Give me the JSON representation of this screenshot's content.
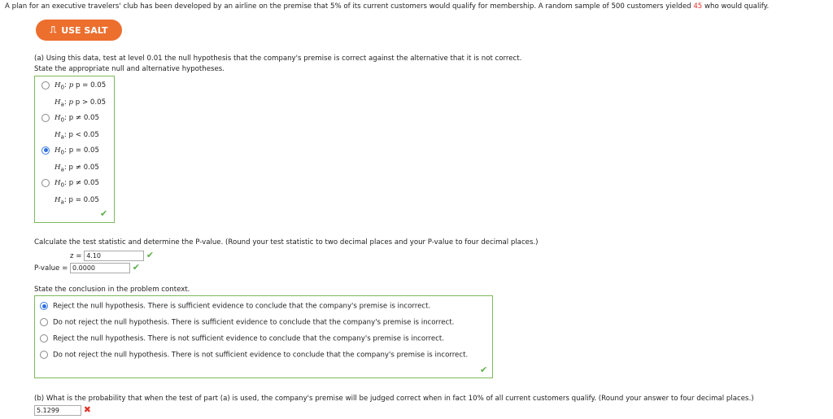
{
  "intro": {
    "text_before": "A plan for an executive travelers' club has been developed by an airline on the premise that 5% of its current customers would qualify for membership. A random sample of 500 customers yielded ",
    "highlight": "45",
    "text_after": " who would qualify."
  },
  "salt_button": {
    "label": "USE SALT",
    "icon": "salt-chart-icon",
    "color": "#ec6f2e"
  },
  "part_a": {
    "prompt": "(a) Using this data, test at level 0.01 the null hypothesis that the company's premise is correct against the alternative that it is not correct.",
    "hyp_prompt": "State the appropriate null and alternative hypotheses.",
    "hypotheses": [
      {
        "h0": "p = 0.05",
        "ha": "p > 0.05",
        "selected": false
      },
      {
        "h0": "p ≠ 0.05",
        "ha": "p < 0.05",
        "selected": false
      },
      {
        "h0": "p = 0.05",
        "ha": "p ≠ 0.05",
        "selected": true
      },
      {
        "h0": "p ≠ 0.05",
        "ha": "p = 0.05",
        "selected": false
      }
    ],
    "calc_prompt": "Calculate the test statistic and determine the P-value. (Round your test statistic to two decimal places and your P-value to four decimal places.)",
    "z_label": "z =",
    "z_value": "4.10",
    "p_label": "P-value =",
    "p_value": "0.0000",
    "conclusion_prompt": "State the conclusion in the problem context.",
    "conclusions": [
      {
        "text": "Reject the null hypothesis. There is sufficient evidence to conclude that the company's premise is incorrect.",
        "selected": true
      },
      {
        "text": "Do not reject the null hypothesis. There is sufficient evidence to conclude that the company's premise is incorrect.",
        "selected": false
      },
      {
        "text": "Reject the null hypothesis. There is not sufficient evidence to conclude that the company's premise is incorrect.",
        "selected": false
      },
      {
        "text": "Do not reject the null hypothesis. There is not sufficient evidence to conclude that the company's premise is incorrect.",
        "selected": false
      }
    ]
  },
  "part_b": {
    "prompt": "(b) What is the probability that when the test of part (a) is used, the company's premise will be judged correct when in fact 10% of all current customers qualify. (Round your answer to four decimal places.)",
    "value": "5.1299"
  },
  "colors": {
    "correct": "#5cae48",
    "incorrect": "#e0342a",
    "box_border": "#7cb95a"
  }
}
